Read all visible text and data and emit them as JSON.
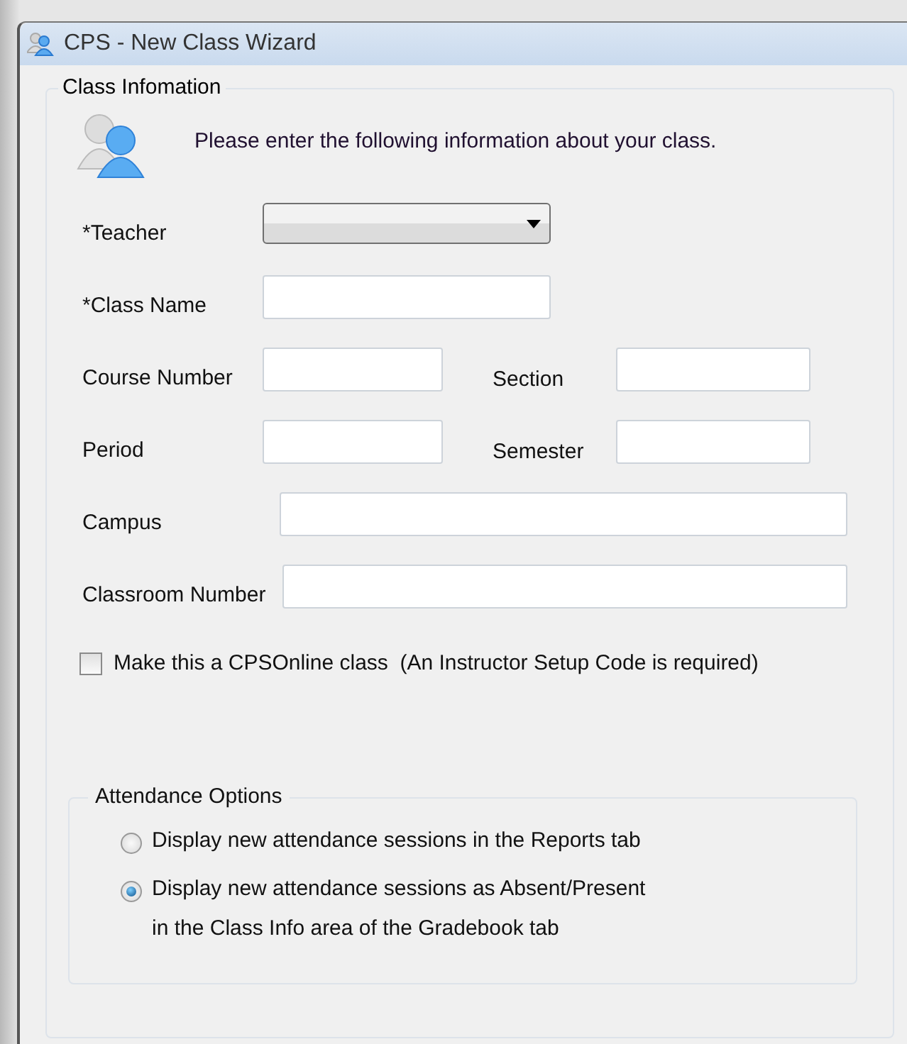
{
  "window": {
    "title": "CPS - New Class Wizard"
  },
  "class_info": {
    "title": "Class Infomation",
    "intro": "Please enter the following information about your class.",
    "rows": [
      {
        "kind": "short",
        "fields": [
          {
            "label": "*Teacher",
            "kind": "dropdown"
          }
        ]
      },
      {
        "kind": "short",
        "fields": [
          {
            "label": "*Class Name",
            "kind": "text"
          }
        ]
      },
      {
        "kind": "pair",
        "fields": [
          {
            "label": "Course Number",
            "kind": "text"
          },
          {
            "label": "Section",
            "kind": "text"
          }
        ]
      },
      {
        "kind": "pair",
        "fields": [
          {
            "label": "Period",
            "kind": "text"
          },
          {
            "label": "Semester",
            "kind": "text"
          }
        ]
      },
      {
        "kind": "wide",
        "fields": [
          {
            "label": "Campus",
            "kind": "text"
          }
        ]
      },
      {
        "kind": "wide",
        "fields": [
          {
            "label": "Classroom Number",
            "kind": "text"
          }
        ]
      }
    ],
    "online": {
      "label": "Make this a CPSOnline class  (An Instructor Setup Code is required)",
      "checked": false
    },
    "attendance": {
      "title": "Attendance Options",
      "options": [
        {
          "label": "Display new attendance sessions in the Reports tab",
          "selected": false
        },
        {
          "label": "Display new attendance sessions as Absent/Present\n in the Class Info area of the Gradebook tab",
          "selected": true
        }
      ]
    }
  }
}
